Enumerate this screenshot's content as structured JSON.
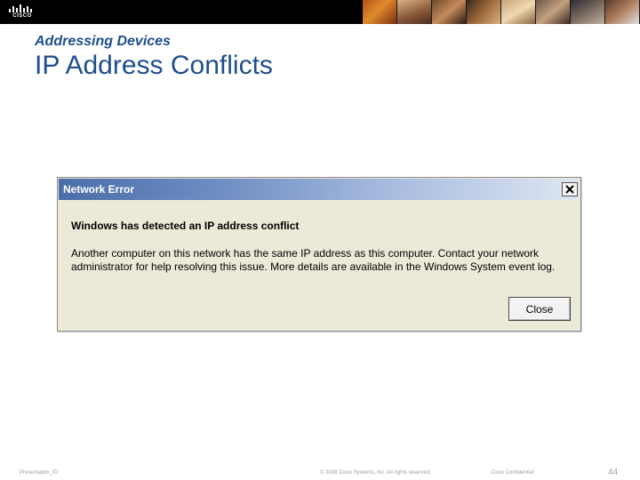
{
  "header": {
    "logo_text": "CISCO",
    "photo_count": 8
  },
  "slide": {
    "subtitle": "Addressing Devices",
    "title": "IP Address Conflicts"
  },
  "dialog": {
    "title": "Network Error",
    "close_icon": "close-x-icon",
    "headline": "Windows has detected an IP address conflict",
    "body": "Another computer on this network has the same IP address as this computer. Contact your network administrator for help resolving this issue. More details are available in the Windows System event log.",
    "close_label": "Close"
  },
  "footer": {
    "presentation": "Presentation_ID",
    "copyright": "© 2008 Cisco Systems, Inc. All rights reserved.",
    "confidential": "Cisco Confidential",
    "page_number": "44"
  },
  "colors": {
    "title_blue": "#1f4f8c",
    "dialog_background": "#ece9d8",
    "titlebar_start": "#4a6ea8",
    "titlebar_end": "#dfe6f3",
    "footer_gray": "#a0a0a0"
  }
}
